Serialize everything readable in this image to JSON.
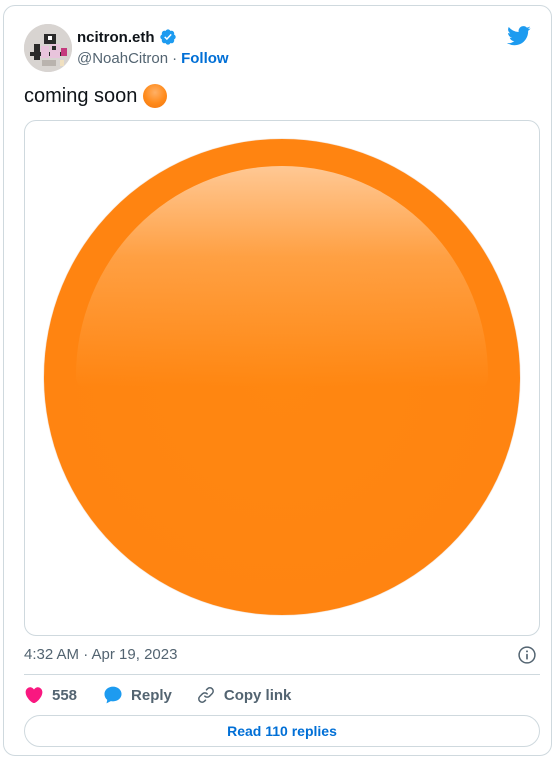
{
  "author": {
    "display_name": "ncitron.eth",
    "handle": "@NoahCitron",
    "separator": "·",
    "follow_label": "Follow",
    "verified": true
  },
  "tweet": {
    "text": "coming soon",
    "emoji": "orange-circle-emoji",
    "timestamp": "4:32 AM · Apr 19, 2023"
  },
  "actions": {
    "like_count": "558",
    "reply_label": "Reply",
    "copy_link_label": "Copy link"
  },
  "read_replies_label": "Read 110 replies",
  "colors": {
    "accent": "#006fd6",
    "like": "#f91880",
    "orange": "#ff8410",
    "text_secondary": "#536471",
    "border": "#cfd9de"
  },
  "icons": {
    "logo": "twitter-bird-icon",
    "verified": "verified-badge-icon",
    "info": "info-icon",
    "like": "heart-icon",
    "reply": "speech-bubble-icon",
    "copy": "link-icon"
  }
}
